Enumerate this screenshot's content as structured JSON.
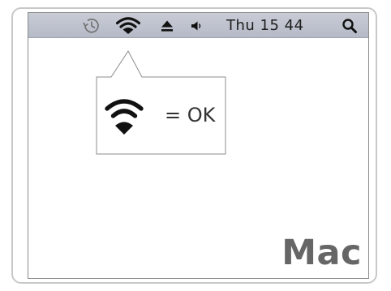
{
  "menubar": {
    "items": [
      {
        "icon": "time-machine-icon"
      },
      {
        "icon": "wifi-icon"
      },
      {
        "icon": "eject-icon"
      },
      {
        "icon": "volume-icon"
      }
    ],
    "clock": "Thu 15 44",
    "search_icon": "spotlight-search-icon"
  },
  "callout": {
    "icon": "wifi-icon",
    "label": "= OK"
  },
  "brand": {
    "label": "Mac"
  },
  "colors": {
    "menubar_top": "#c9ccd5",
    "menubar_bottom": "#b5bac7",
    "frame_border": "#c8c8c8",
    "brand_text": "#666666"
  }
}
